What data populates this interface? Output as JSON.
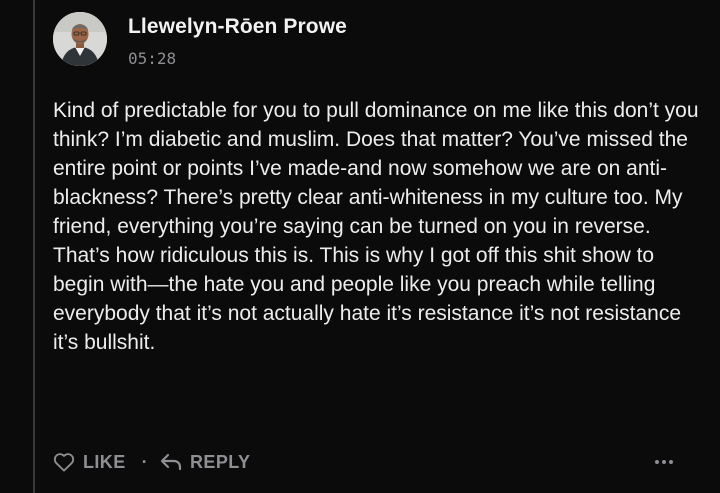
{
  "comment": {
    "author": "Llewelyn-Rōen Prowe",
    "timestamp": "05:28",
    "body": "Kind of predictable for you to pull dominance on me like this don’t you think? I’m diabetic and muslim. Does that matter? You’ve missed the entire point or points I’ve made-and now somehow we are on anti-blackness? There’s pretty clear anti-whiteness in my culture too. My friend, everything you’re saying can be turned on you in reverse. That’s how ridiculous this is. This is why I got off this shit show to begin with—the hate you and people like you preach while telling everybody that it’s not actually hate it’s resistance it’s not resistance it’s bullshit."
  },
  "actions": {
    "like_label": "LIKE",
    "separator": "·",
    "reply_label": "REPLY"
  },
  "icons": {
    "like": "heart-icon",
    "reply": "reply-arrow-icon",
    "more": "more-dots-icon"
  },
  "colors": {
    "background": "#0b0b0c",
    "text": "#ededed",
    "muted": "#8e8e93",
    "thread_line": "#3a3a3c"
  }
}
